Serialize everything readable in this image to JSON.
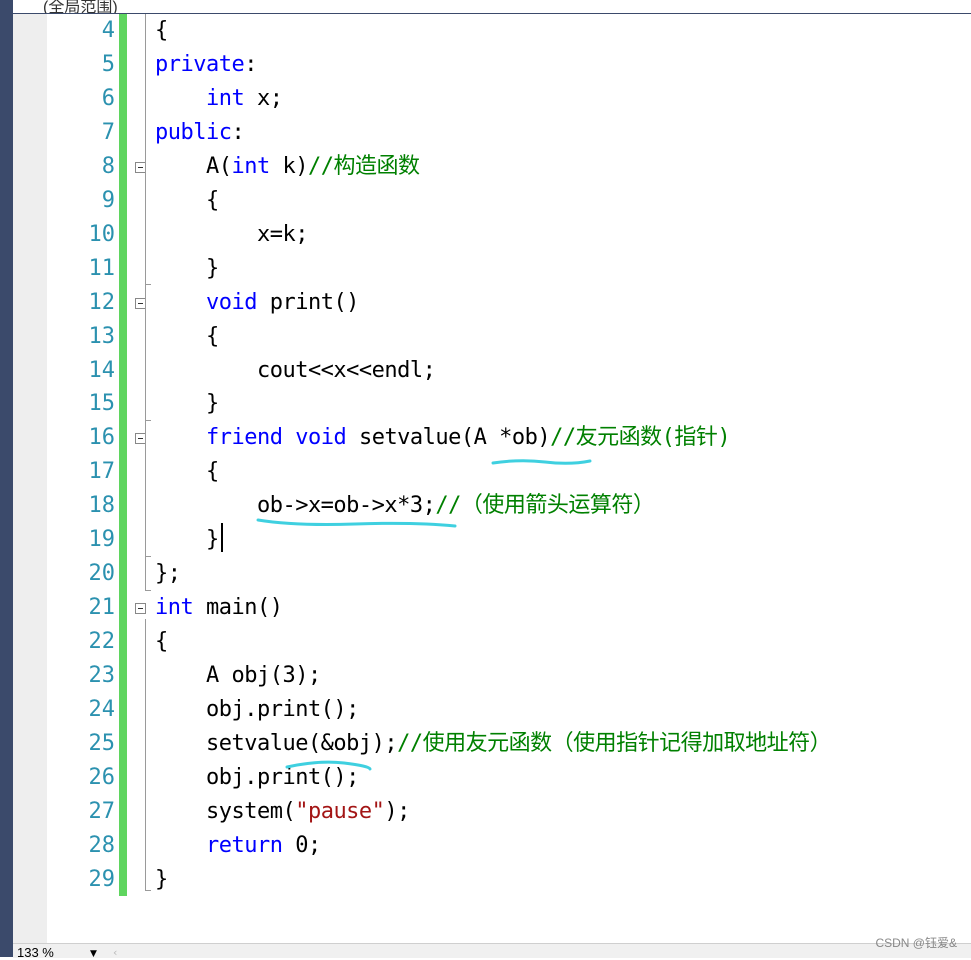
{
  "window": {
    "tab_title_partial": "(全局范围)"
  },
  "editor": {
    "lines": [
      {
        "num": "4",
        "segs": [
          [
            "{",
            "p"
          ]
        ]
      },
      {
        "num": "5",
        "segs": [
          [
            "private",
            "kw"
          ],
          [
            ":",
            "p"
          ]
        ]
      },
      {
        "num": "6",
        "segs": [
          [
            "    ",
            "p"
          ],
          [
            "int",
            "kw"
          ],
          [
            " x;",
            "p"
          ]
        ]
      },
      {
        "num": "7",
        "segs": [
          [
            "public",
            "kw"
          ],
          [
            ":",
            "p"
          ]
        ]
      },
      {
        "num": "8",
        "segs": [
          [
            "    A(",
            "p"
          ],
          [
            "int",
            "kw"
          ],
          [
            " k)",
            "p"
          ],
          [
            "//构造函数",
            "cm"
          ]
        ]
      },
      {
        "num": "9",
        "segs": [
          [
            "    {",
            "p"
          ]
        ]
      },
      {
        "num": "10",
        "segs": [
          [
            "        x=k;",
            "p"
          ]
        ]
      },
      {
        "num": "11",
        "segs": [
          [
            "    }",
            "p"
          ]
        ]
      },
      {
        "num": "12",
        "segs": [
          [
            "    ",
            "p"
          ],
          [
            "void",
            "kw"
          ],
          [
            " print()",
            "p"
          ]
        ]
      },
      {
        "num": "13",
        "segs": [
          [
            "    {",
            "p"
          ]
        ]
      },
      {
        "num": "14",
        "segs": [
          [
            "        cout<<x<<endl;",
            "p"
          ]
        ]
      },
      {
        "num": "15",
        "segs": [
          [
            "    }",
            "p"
          ]
        ]
      },
      {
        "num": "16",
        "segs": [
          [
            "    ",
            "p"
          ],
          [
            "friend",
            "kw"
          ],
          [
            " ",
            "p"
          ],
          [
            "void",
            "kw"
          ],
          [
            " setvalue(A *ob)",
            "p"
          ],
          [
            "//友元函数(指针)",
            "cm"
          ]
        ]
      },
      {
        "num": "17",
        "segs": [
          [
            "    {",
            "p"
          ]
        ]
      },
      {
        "num": "18",
        "segs": [
          [
            "        ob->x=ob->x*3;",
            "p"
          ],
          [
            "//（使用箭头运算符）",
            "cm"
          ]
        ]
      },
      {
        "num": "19",
        "segs": [
          [
            "    }",
            "p"
          ]
        ]
      },
      {
        "num": "20",
        "segs": [
          [
            "};",
            "p"
          ]
        ]
      },
      {
        "num": "21",
        "segs": [
          [
            "int",
            "kw"
          ],
          [
            " main()",
            "p"
          ]
        ]
      },
      {
        "num": "22",
        "segs": [
          [
            "{",
            "p"
          ]
        ]
      },
      {
        "num": "23",
        "segs": [
          [
            "    A obj(3);",
            "p"
          ]
        ]
      },
      {
        "num": "24",
        "segs": [
          [
            "    obj.print();",
            "p"
          ]
        ]
      },
      {
        "num": "25",
        "segs": [
          [
            "    setvalue(&obj);",
            "p"
          ],
          [
            "//使用友元函数（使用指针记得加取地址符）",
            "cm"
          ]
        ]
      },
      {
        "num": "26",
        "segs": [
          [
            "    obj.print();",
            "p"
          ]
        ]
      },
      {
        "num": "27",
        "segs": [
          [
            "    system(",
            "p"
          ],
          [
            "\"pause\"",
            "str"
          ],
          [
            ");",
            "p"
          ]
        ]
      },
      {
        "num": "28",
        "segs": [
          [
            "    ",
            "p"
          ],
          [
            "return",
            "kw"
          ],
          [
            " 0;",
            "p"
          ]
        ]
      },
      {
        "num": "29",
        "segs": [
          [
            "}",
            "p"
          ]
        ]
      }
    ],
    "fold_lines": [
      "8",
      "12",
      "16",
      "21"
    ]
  },
  "status": {
    "zoom": "133 %",
    "zoom_dropdown_icon": "triangle-down-icon",
    "scroll_left_icon": "chevron-left-icon"
  },
  "watermark": "CSDN @钰爱&",
  "colors": {
    "keyword": "#0000ff",
    "comment": "#008000",
    "string": "#a31515",
    "line_number": "#2b91af",
    "change_bar": "#5fd55f",
    "squiggle": "#3fd0e0"
  }
}
